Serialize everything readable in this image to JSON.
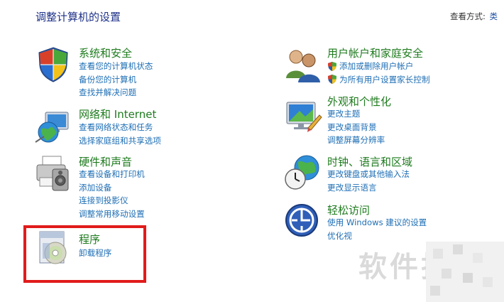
{
  "header": {
    "title": "调整计算机的设置",
    "view_by_label": "查看方式:",
    "view_by_value": "类"
  },
  "categories": [
    {
      "name": "系统和安全",
      "icon": "shield-flag-icon",
      "links": [
        "查看您的计算机状态",
        "备份您的计算机",
        "查找并解决问题"
      ]
    },
    {
      "name": "网络和 Internet",
      "icon": "network-globe-icon",
      "links": [
        "查看网络状态和任务",
        "选择家庭组和共享选项"
      ]
    },
    {
      "name": "硬件和声音",
      "icon": "printer-speaker-icon",
      "links": [
        "查看设备和打印机",
        "添加设备",
        "连接到投影仪",
        "调整常用移动设置"
      ]
    },
    {
      "name": "程序",
      "icon": "programs-disc-icon",
      "links": [
        "卸载程序"
      ]
    },
    {
      "name": "用户帐户和家庭安全",
      "icon": "users-icon",
      "links": [
        "添加或删除用户帐户",
        "为所有用户设置家长控制"
      ]
    },
    {
      "name": "外观和个性化",
      "icon": "monitor-paint-icon",
      "links": [
        "更改主题",
        "更改桌面背景",
        "调整屏幕分辨率"
      ]
    },
    {
      "name": "时钟、语言和区域",
      "icon": "clock-globe-icon",
      "links": [
        "更改键盘或其他输入法",
        "更改显示语言"
      ]
    },
    {
      "name": "轻松访问",
      "icon": "ease-of-access-icon",
      "links": [
        "使用 Windows 建议的设置",
        "优化视"
      ]
    }
  ],
  "watermark": "软件技巧",
  "colors": {
    "category_heading": "#1e7b1e",
    "link": "#1f6fb5",
    "title": "#1e3287",
    "highlight_box": "#e11b1b"
  }
}
